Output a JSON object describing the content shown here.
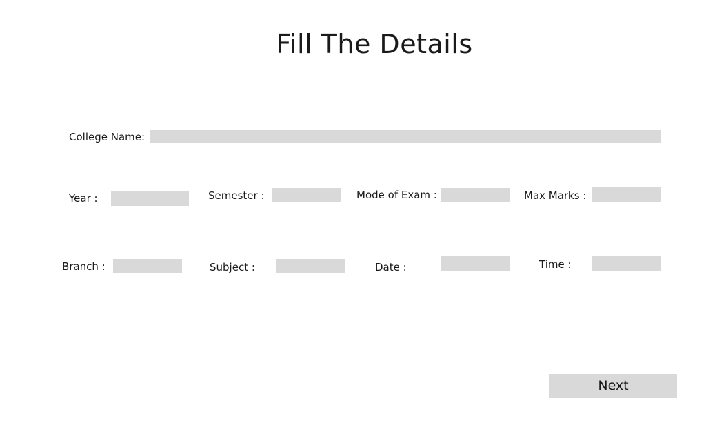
{
  "page": {
    "title": "Fill The Details"
  },
  "form": {
    "college_name": {
      "label": "College Name:",
      "value": ""
    },
    "year": {
      "label": "Year :",
      "value": ""
    },
    "semester": {
      "label": "Semester :",
      "value": ""
    },
    "mode_of_exam": {
      "label": "Mode of Exam :",
      "value": ""
    },
    "max_marks": {
      "label": "Max Marks :",
      "value": ""
    },
    "branch": {
      "label": "Branch :",
      "value": ""
    },
    "subject": {
      "label": "Subject :",
      "value": ""
    },
    "date": {
      "label": "Date :",
      "value": ""
    },
    "time": {
      "label": "Time :",
      "value": ""
    }
  },
  "actions": {
    "next_label": "Next"
  },
  "colors": {
    "background": "#ffffff",
    "field_fill": "#d9d9d9",
    "text": "#1a1a1a"
  }
}
